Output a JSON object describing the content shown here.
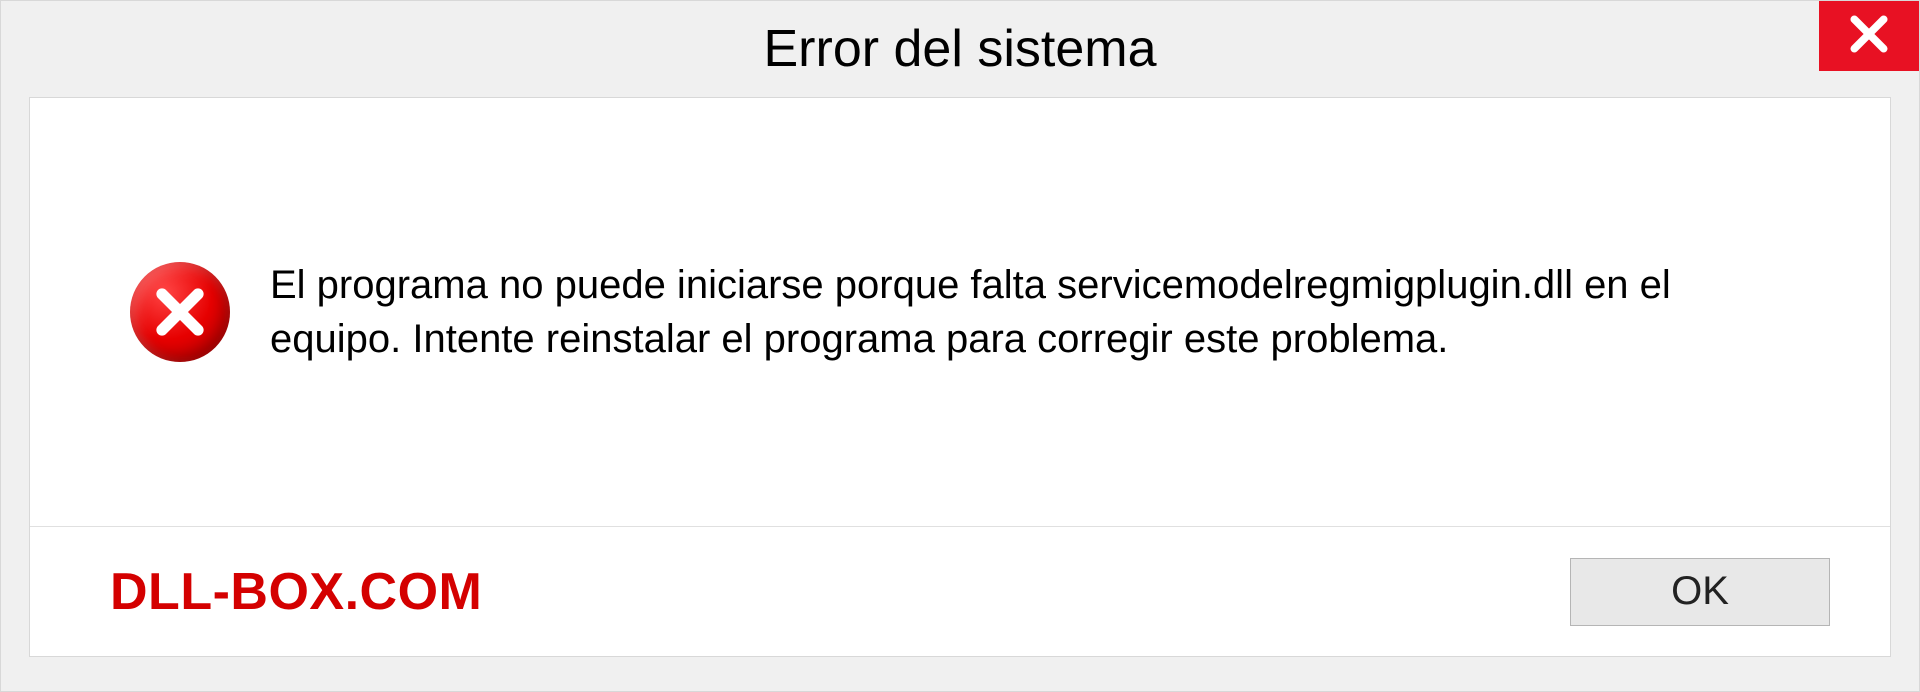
{
  "dialog": {
    "title": "Error del sistema",
    "message": "El programa no puede iniciarse porque falta servicemodelregmigplugin.dll en el equipo. Intente reinstalar el programa para corregir este problema.",
    "ok_label": "OK"
  },
  "watermark": {
    "text": "DLL-BOX.COM"
  },
  "colors": {
    "close_bg": "#e81123",
    "error_red": "#d40000",
    "window_bg": "#f0f0f0",
    "content_bg": "#ffffff"
  }
}
